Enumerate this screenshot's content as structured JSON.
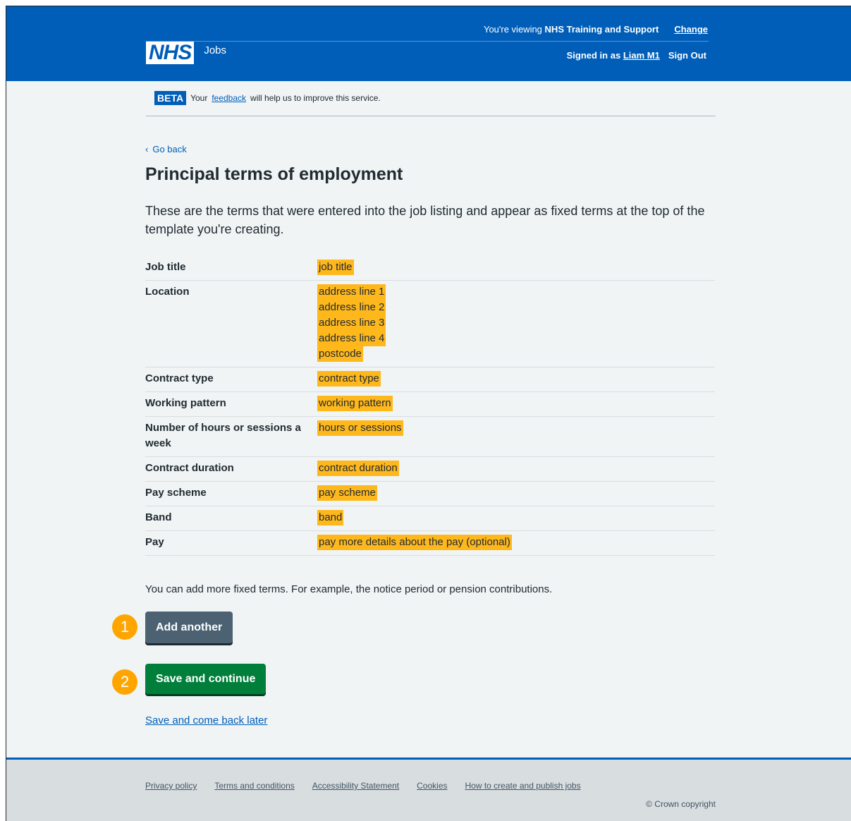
{
  "header": {
    "viewing_prefix": "You're viewing",
    "viewing_org": "NHS Training and Support",
    "change_link": "Change",
    "signed_in_prefix": "Signed in as",
    "user": "Liam M1",
    "sign_out": "Sign Out",
    "logo_text": "NHS",
    "service_name": "Jobs"
  },
  "beta": {
    "tag": "BETA",
    "text_before": "Your",
    "link": "feedback",
    "text_after": "will help us to improve this service."
  },
  "nav": {
    "go_back": "Go back"
  },
  "page": {
    "title": "Principal terms of employment",
    "lead": "These are the terms that were entered into the job listing and appear as fixed terms at the top of the template you're creating.",
    "more_text": "You can add more fixed terms. For example, the notice period or pension contributions."
  },
  "terms": [
    {
      "key": "Job title",
      "values": [
        "job title"
      ]
    },
    {
      "key": "Location",
      "values": [
        "address line 1",
        "address line 2",
        "address line 3",
        "address line 4",
        "postcode"
      ]
    },
    {
      "key": "Contract type",
      "values": [
        "contract type"
      ]
    },
    {
      "key": "Working pattern",
      "values": [
        "working pattern"
      ]
    },
    {
      "key": "Number of hours or sessions a week",
      "values": [
        "hours or sessions"
      ]
    },
    {
      "key": "Contract duration",
      "values": [
        "contract duration"
      ]
    },
    {
      "key": "Pay scheme",
      "values": [
        "pay scheme"
      ]
    },
    {
      "key": "Band",
      "values": [
        "band"
      ]
    },
    {
      "key": "Pay",
      "values": [
        "pay more details about the pay (optional)"
      ]
    }
  ],
  "buttons": {
    "add_another": "Add another",
    "save_continue": "Save and continue",
    "save_later": "Save and come back later"
  },
  "markers": [
    "1",
    "2"
  ],
  "footer": {
    "links": [
      "Privacy policy",
      "Terms and conditions",
      "Accessibility Statement",
      "Cookies",
      "How to create and publish jobs"
    ],
    "copyright": "© Crown copyright"
  },
  "colors": {
    "nhs_blue": "#005eb8",
    "highlight": "#ffb81c",
    "green": "#007f3b",
    "grey_button": "#4c6272",
    "marker": "#ffa500"
  }
}
